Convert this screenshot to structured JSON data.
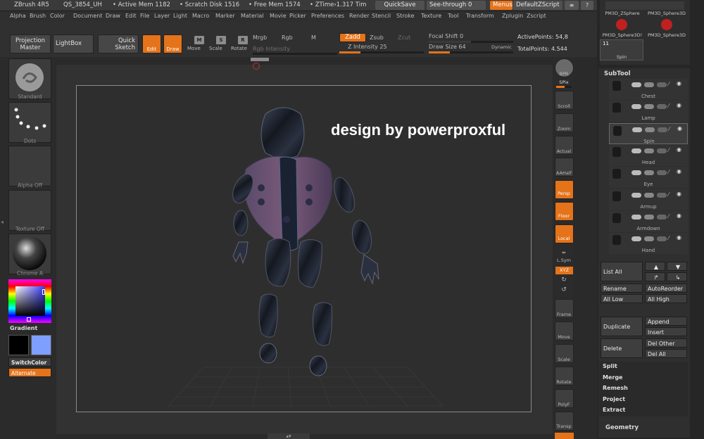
{
  "titlebar": {
    "app": "ZBrush 4R5",
    "project": "QS_3854_UH",
    "active_mem": "• Active Mem 1182",
    "scratch": "• Scratch Disk 1516",
    "free_mem": "• Free Mem 1574",
    "ztime": "• ZTime›1.317 Tim",
    "quicksave": "QuickSave",
    "seethrough": "See-through  0",
    "menus": "Menus",
    "script": "DefaultZScript"
  },
  "menubar": [
    "Alpha",
    "Brush",
    "Color",
    "Document",
    "Draw",
    "Edit",
    "File",
    "Layer",
    "Light",
    "Macro",
    "Marker",
    "Material",
    "Movie",
    "Picker",
    "Preferences",
    "Render",
    "Stencil",
    "Stroke",
    "Texture",
    "Tool",
    "Transform",
    "Zplugin",
    "Zscript"
  ],
  "shelf": {
    "projection_master": "Projection Master",
    "lightbox": "LightBox",
    "quick_sketch": "Quick Sketch",
    "edit": "Edit",
    "draw": "Draw",
    "move": "Move",
    "scale": "Scale",
    "rotate": "Rotate",
    "mrgb": "Mrgb",
    "rgb": "Rgb",
    "m": "M",
    "zadd": "Zadd",
    "zsub": "Zsub",
    "zcut": "Zcut",
    "rgb_intensity": "Rgb Intensity",
    "z_intensity": "Z Intensity 25",
    "z_intensity_value": 25,
    "focal_shift": "Focal Shift 0",
    "draw_size": "Draw Size 64",
    "draw_size_value": 64,
    "dynamic": "Dynamic",
    "active_points": "ActivePoints: 54,8",
    "total_points": "TotalPoints: 4.544"
  },
  "lefttray": {
    "standard": "Standard",
    "dots": "Dots",
    "alpha_off": "Alpha  Off",
    "texture_off": "Texture  Off",
    "chrome": "Chrome  A",
    "gradient": "Gradient",
    "switchcolor": "SwitchColor",
    "alternate": "Alternate"
  },
  "canvas": {
    "watermark": "design by powerproxful"
  },
  "righttools": {
    "bpr": "BPR",
    "spix": "SPix",
    "scroll": "Scroll",
    "zoom": "Zoom",
    "actual": "Actual",
    "aahalf": "AAHalf",
    "persp": "Persp",
    "floor": "Floor",
    "local": "Local",
    "lsym": "L.Sym",
    "xyz": "XYZ",
    "frame": "Frame",
    "move": "Move",
    "scale": "Scale",
    "rotate": "Rotate",
    "polyf": "PolyF",
    "transp": "Transp"
  },
  "righttray": {
    "tool1": "PM3D_ZSphere",
    "tool2": "PM3D_Sphere3D",
    "tool3": "PM3D_Sphere3D!",
    "tool4": "PM3D_Sphere3D",
    "spin_count": "11",
    "spin_label": "Spin",
    "subtool_title": "SubTool",
    "subtools": [
      "Chest",
      "Lamp",
      "Spin",
      "Head",
      "Eye",
      "Armup",
      "Armdown",
      "Hand"
    ],
    "list_all": "List All",
    "rename": "Rename",
    "autoreorder": "AutoReorder",
    "all_low": "All Low",
    "all_high": "All High",
    "duplicate": "Duplicate",
    "append": "Append",
    "insert": "Insert",
    "delete": "Delete",
    "del_other": "Del Other",
    "del_all": "Del All",
    "split": "Split",
    "merge": "Merge",
    "remesh": "Remesh",
    "project": "Project",
    "extract": "Extract",
    "geometry": "Geometry"
  },
  "colors": {
    "accent": "#e4731a",
    "primary_swatch": "#000000",
    "secondary_swatch": "#7f9fff"
  }
}
